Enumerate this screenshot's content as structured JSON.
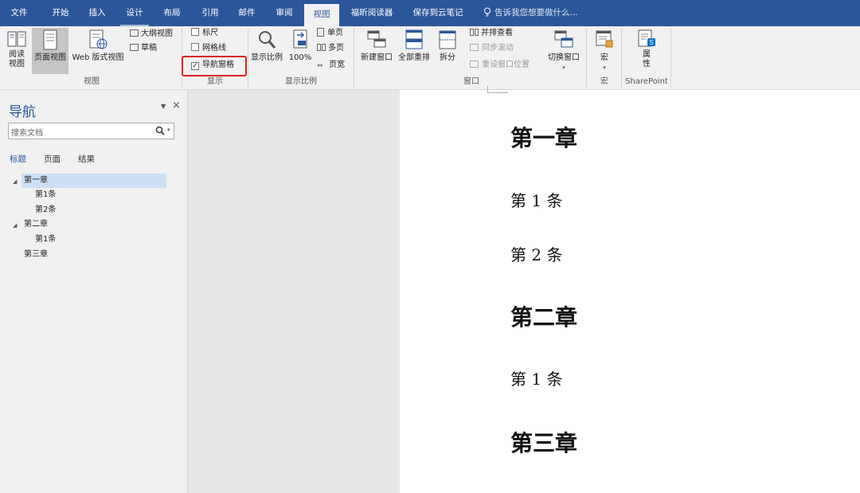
{
  "tabs": [
    "文件",
    "开始",
    "插入",
    "设计",
    "布局",
    "引用",
    "邮件",
    "审阅",
    "视图",
    "福昕阅读器",
    "保存到云笔记"
  ],
  "active_tab": "视图",
  "tell_me": "告诉我您想要做什么...",
  "ribbon": {
    "views": {
      "read_mode": "阅读\n视图",
      "print_layout": "页面视图",
      "web_layout": "Web 版式视图",
      "outline": "大纲视图",
      "draft": "草稿",
      "group_label": "视图"
    },
    "show": {
      "ruler": "标尺",
      "gridlines": "网格线",
      "nav_pane": "导航窗格",
      "ruler_checked": false,
      "gridlines_checked": false,
      "nav_pane_checked": true,
      "group_label": "显示"
    },
    "zoom": {
      "zoom": "显示比例",
      "hundred": "100%",
      "one_page": "单页",
      "multi_page": "多页",
      "page_width": "页宽",
      "group_label": "显示比例"
    },
    "window": {
      "new_window": "新建窗口",
      "arrange_all": "全部重排",
      "split": "拆分",
      "side_by_side": "并排查看",
      "sync_scroll": "同步滚动",
      "reset_position": "重设窗口位置",
      "switch_windows": "切换窗口",
      "group_label": "窗口"
    },
    "macros": {
      "macros": "宏",
      "group_label": "宏"
    },
    "sharepoint": {
      "properties": "属\n性",
      "group_label": "SharePoint"
    }
  },
  "nav_pane": {
    "title": "导航",
    "search_placeholder": "搜索文档",
    "tabs": [
      "标题",
      "页面",
      "结果"
    ],
    "active_tab": "标题",
    "tree": [
      {
        "text": "第一章",
        "level": 1,
        "expanded": true,
        "selected": true
      },
      {
        "text": "第1条",
        "level": 2
      },
      {
        "text": "第2条",
        "level": 2
      },
      {
        "text": "第二章",
        "level": 1,
        "expanded": true
      },
      {
        "text": "第1条",
        "level": 2
      },
      {
        "text": "第三章",
        "level": 1
      }
    ]
  },
  "document": {
    "lines": [
      {
        "text": "第一章",
        "style": "heading"
      },
      {
        "text": "第 1 条",
        "style": "body"
      },
      {
        "text": "第 2 条",
        "style": "body"
      },
      {
        "text": "第二章",
        "style": "heading"
      },
      {
        "text": "第 1 条",
        "style": "body"
      },
      {
        "text": "第三章",
        "style": "heading"
      }
    ]
  },
  "colors": {
    "accent": "#2b579a",
    "highlight_box": "#e02020",
    "selected_node": "#cce0f5"
  }
}
